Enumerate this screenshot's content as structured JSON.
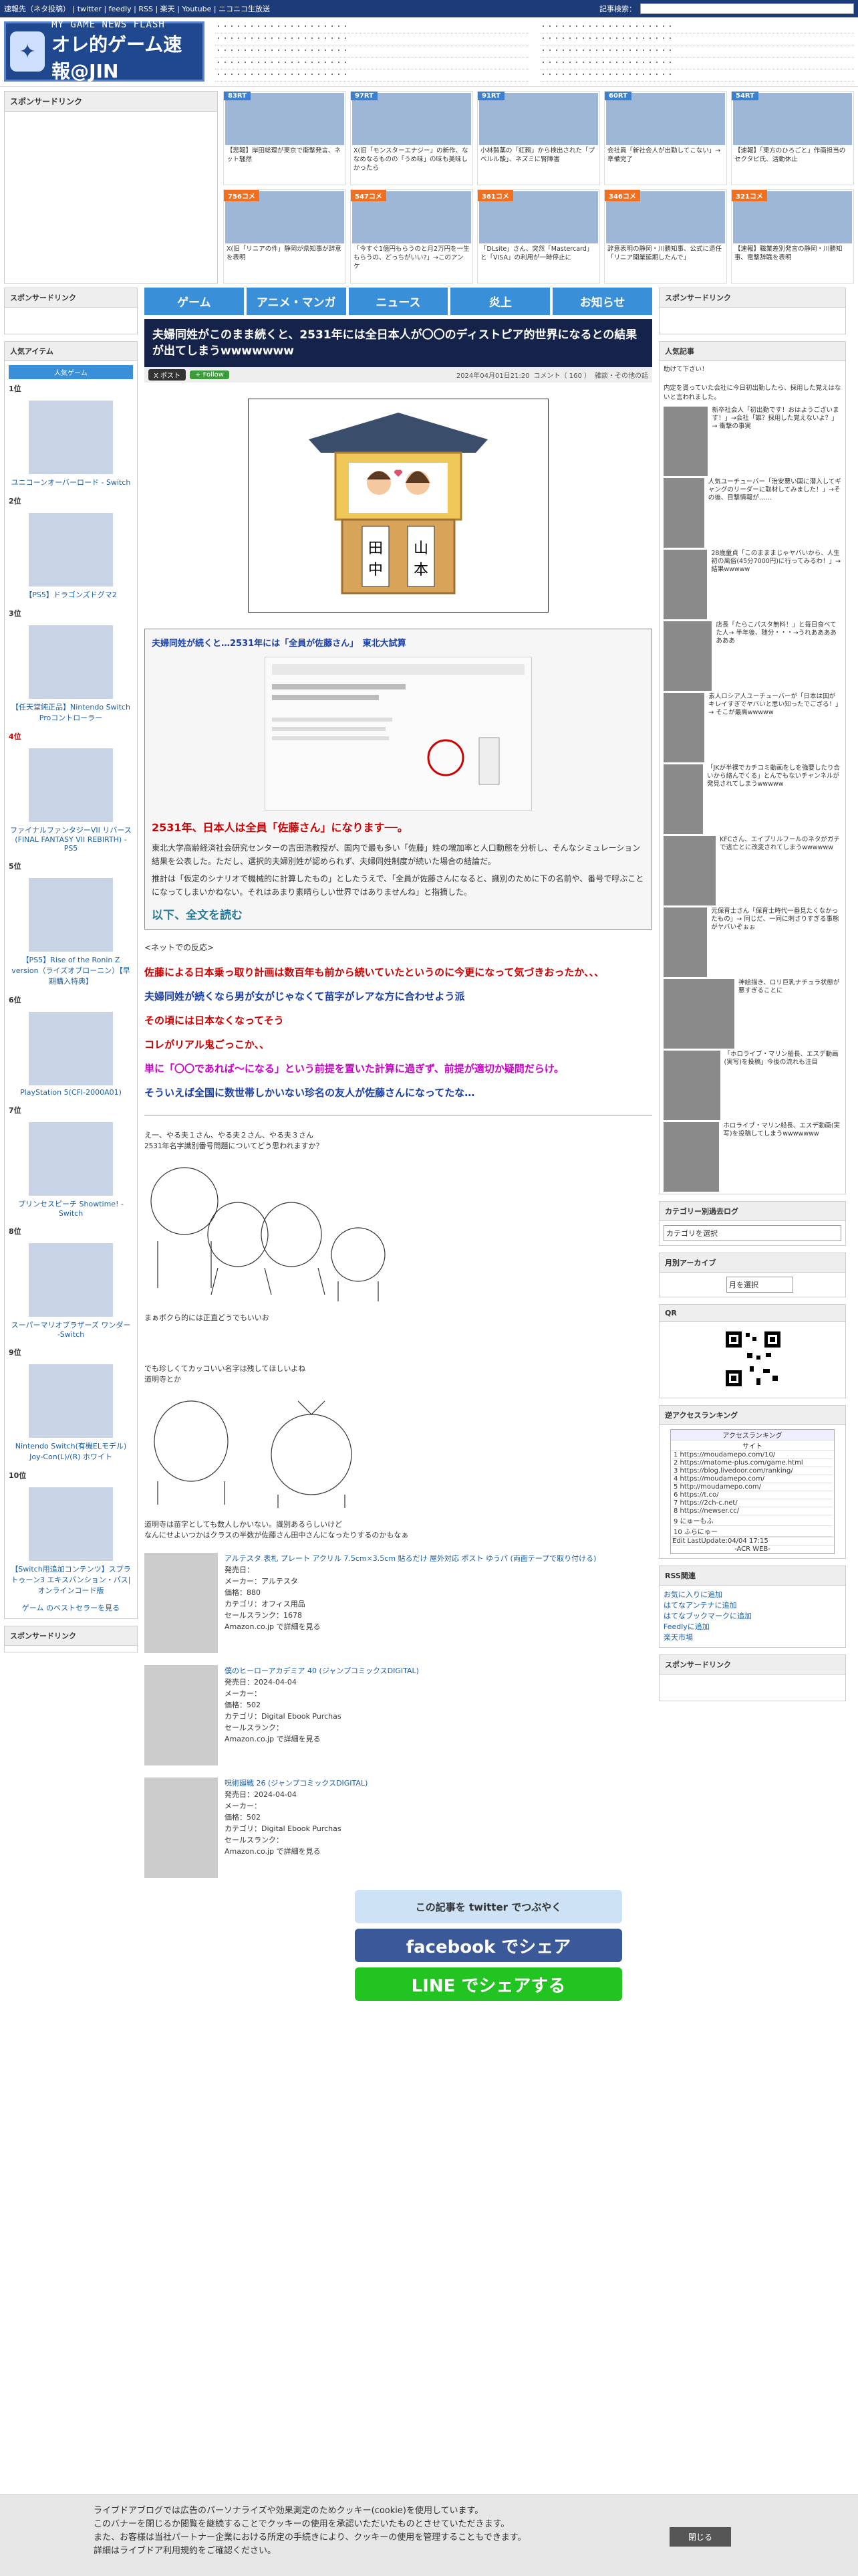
{
  "topbar": {
    "links": "速報先（ネタ投稿） | twitter | feedly | RSS | 楽天 | Youtube | ニコニコ生放送",
    "search_label": "記事検索："
  },
  "site": {
    "title_en": "MY GAME NEWS FLASH",
    "title_jp": "オレ的ゲーム速報@JIN"
  },
  "sponsored": "スポンサードリンク",
  "thumbs": [
    {
      "badge": "83RT",
      "caption": "【悲報】岸田総理が東京で衝撃発言、ネット騒然",
      "color": "#3a7fd0"
    },
    {
      "badge": "97RT",
      "caption": "X(旧「モンスターエナジー」の新作、ななめなるものの「うめ味」の味も美味しかったら",
      "color": "#3a7fd0"
    },
    {
      "badge": "91RT",
      "caption": "小林製薬の「紅麹」から検出された「プベルル酸」、ネズミに腎障害",
      "color": "#3a7fd0"
    },
    {
      "badge": "60RT",
      "caption": "会社員「新社会人が出勤してこない」→準備完了",
      "color": "#3a7fd0"
    },
    {
      "badge": "54RT",
      "caption": "【速報】「東方のひろごと」作画担当のセクタビ氏、活動休止",
      "color": "#3a7fd0"
    },
    {
      "badge": "756コメ",
      "caption": "X(旧「リニアの件」静岡が県知事が辞意を表明",
      "color": "#f07020"
    },
    {
      "badge": "547コメ",
      "caption": "「今すぐ1億円もらうのと月2万円を一生もらうの、どっちがいい?」→このアンケ",
      "color": "#f07020"
    },
    {
      "badge": "361コメ",
      "caption": "「DLsite」さん、突然「Mastercard」と「VISA」の利用が一時停止に",
      "color": "#f07020"
    },
    {
      "badge": "346コメ",
      "caption": "辞意表明の静岡・川勝知事、公式に退任「リニア開業延期したんで」",
      "color": "#f07020"
    },
    {
      "badge": "321コメ",
      "caption": "【速報】職業差別発言の静岡・川勝知事、電撃辞職を表明",
      "color": "#f07020"
    }
  ],
  "nav": [
    "ゲーム",
    "アニメ・マンガ",
    "ニュース",
    "炎上",
    "お知らせ"
  ],
  "article": {
    "title": "夫婦同姓がこのまま続くと、2531年には全日本人が〇〇のディストピア的世界になるとの結果が出てしまうwwwwwww",
    "date": "2024年04月01日21:20",
    "comments": "コメント（ 160 ）",
    "cat": "雑談・その他の話",
    "quote_title": "夫婦同姓が続くと…2531年には「全員が佐藤さん」　東北大試算",
    "big": "2531年、日本人は全員「佐藤さん」になります──。",
    "p1": "東北大学高齢経済社会研究センターの吉田浩教授が、国内で最も多い「佐藤」姓の増加率と人口動態を分析し、そんなシミュレーション結果を公表した。ただし、選択的夫婦別姓が認められず、夫婦同姓制度が続いた場合の結論だ。",
    "p2": "推計は「仮定のシナリオで機械的に計算したもの」としたうえで、「全員が佐藤さんになると、識別のために下の名前や、番号で呼ぶことになってしまいかねない。それはあまり素晴らしい世界ではありませんね」と指摘した。",
    "more": "以下、全文を読む",
    "net": "<ネットでの反応>",
    "reactions": [
      {
        "t": "佐藤による日本乗っ取り計画は数百年も前から続いていたというのに今更になって気づきおったか、、、",
        "c": "#c00"
      },
      {
        "t": "夫婦同姓が続くなら男が女がじゃなくて苗字がレアな方に合わせよう派",
        "c": "#1a3ea8"
      },
      {
        "t": "その頃には日本なくなってそう",
        "c": "#c00"
      },
      {
        "t": "コレがリアル鬼ごっこか、、",
        "c": "#c00"
      },
      {
        "t": "単に「〇〇であれば〜になる」という前提を置いた計算に過ぎず、前提が適切か疑問だらけ。",
        "c": "#c0c"
      },
      {
        "t": "そういえば全国に数世帯しかいない珍名の友人が佐藤さんになってたな…",
        "c": "#1a3ea8"
      }
    ],
    "aa1": "え一、やる夫１さん、やる夫２さん、やる夫３さん\n2531年名字識別番号問題についてどう思われますか？",
    "aa1b": "まぁボクら的には正直どうでもいいお",
    "aa2": "でも珍しくてカッコいい名字は残してほしいよね\n道明寺とか",
    "aa2b": "道明寺は苗字としても数人しかいない。識別あるらしいけど\nなんにせよいつかはクラスの半数が佐藤さん田中さんになったりするのかもなぁ",
    "products": [
      {
        "title": "アルテスタ 表札 プレート アクリル 7.5cm×3.5cm 貼るだけ 屋外対応 ポスト ゆうパ (両面テープで取り付ける)",
        "lines": [
          "発売日：",
          "メーカー：アルテスタ",
          "価格：880",
          "カテゴリ：オフィス用品",
          "セールスランク：1678",
          "Amazon.co.jp で詳細を見る"
        ]
      },
      {
        "title": "僕のヒーローアカデミア 40 (ジャンプコミックスDIGITAL)",
        "lines": [
          "発売日：2024-04-04",
          "メーカー：",
          "価格：502",
          "カテゴリ：Digital Ebook Purchas",
          "セールスランク：",
          "Amazon.co.jp で詳細を見る"
        ]
      },
      {
        "title": "呪術廻戦 26 (ジャンプコミックスDIGITAL)",
        "lines": [
          "発売日：2024-04-04",
          "メーカー：",
          "価格：502",
          "カテゴリ：Digital Ebook Purchas",
          "セールスランク：",
          "Amazon.co.jp で詳細を見る"
        ]
      }
    ],
    "share": [
      {
        "t": "この記事を twitter でつぶやく",
        "c": "#cde3f5"
      },
      {
        "t": "facebook でシェア",
        "c": "#3b5998"
      },
      {
        "t": "LINE でシェアする",
        "c": "#21c421"
      }
    ]
  },
  "left": {
    "popular": "人気アイテム",
    "tab": "人気ゲーム",
    "items": [
      {
        "rank": "1位",
        "name": "ユニコーンオーバーロード - Switch"
      },
      {
        "rank": "2位",
        "name": "【PS5】ドラゴンズドグマ2"
      },
      {
        "rank": "3位",
        "name": "【任天堂純正品】Nintendo Switch Proコントローラー"
      },
      {
        "rank": "4位",
        "name": "ファイナルファンタジーVII リバース(FINAL FANTASY VII REBIRTH) -PS5"
      },
      {
        "rank": "5位",
        "name": "【PS5】Rise of the Ronin Z version（ライズオブローニン）【早期購入特典】"
      },
      {
        "rank": "6位",
        "name": "PlayStation 5(CFI-2000A01)"
      },
      {
        "rank": "7位",
        "name": "プリンセスピーチ Showtime! -Switch"
      },
      {
        "rank": "8位",
        "name": "スーパーマリオブラザーズ ワンダー -Switch"
      },
      {
        "rank": "9位",
        "name": "Nintendo Switch(有機ELモデル) Joy-Con(L)/(R) ホワイト"
      },
      {
        "rank": "10位",
        "name": "【Switch用追加コンテンツ】スプラトゥーン3 エキスパンション・パス|オンラインコード版"
      }
    ],
    "bestseller": "ゲーム のベストセラーを見る",
    "sponsored2": "スポンサードリンク"
  },
  "right": {
    "sponsored": "スポンサードリンク",
    "popular": "人気記事",
    "intro": "助けて下さい！\n\n内定を貰っていた会社に今日初出勤したら、採用した覚えはないと言われました。",
    "articles": [
      "新卒社会人「初出勤です！おはようございます！」→会社「誰？採用した覚えないよ？」→ 衝撃の事実",
      "人気ユーチューバー「治安悪い国に潜入してギャングのリーダーに取材してみました！」→その後、目撃情報が……",
      "28歳童貞「このまままじゃヤバいから、人生初の風俗(45分7000円)に行ってみるわ！」→ 結果wwwww",
      "店長「たらこパスタ無料！」と毎日食べてた人→ 半年後、随分・・・→うれあああああああ",
      "素人ロシア人ユーチューバーが「日本は国がキレイすぎでヤバいと思い知ったでござる！」→ そこが最高wwwww",
      "「JKが半裸でカチコミ動画をしを強要したり合いから絡んでくる」とんでもないチャンネルが発見されてしまうwwwww",
      "KFCさん、エイプリルフールのネタがガチで逃亡とに改変されてしまうwwwwww",
      "元保育士さん「保育士時代一番見たくなかったもの」→ 同じだ、一同に刺さりすぎる事態がヤバいぞぉぉ",
      "神絵描き、ロリ巨乳ナチュラ状態が悪すぎることに",
      "「ホロライブ・マリン船長、エスデ動画(実写)を投稿」今後の流れも注目",
      "ホロライブ・マリン船長、エスデ動画(実写)を投稿してしまうwwwwwww"
    ],
    "cat_log": "カテゴリー別過去ログ",
    "cat_select": "カテゴリを選択",
    "monthly": "月別アーカイブ",
    "month_select": "月を選択",
    "qr": "QR",
    "acr": "逆アクセスランキング",
    "acr_title": "アクセスランキング",
    "acr_head": "サイト",
    "acr_rows": [
      "1 https://moudamepo.com/10/",
      "2 https://matome-plus.com/game.html",
      "3 https://blog.livedoor.com/ranking/",
      "4 https://moudamepo.com/",
      "5 http://moudamepo.com/",
      "6 https://t.co/",
      "7 https://2ch-c.net/",
      "8 https://newser.cc/",
      "9 にゅーもふ",
      "10 ふらにゅー"
    ],
    "acr_update": "Edit  LastUpdate:04/04 17:15",
    "acr_web": "-ACR WEB-",
    "rss": "RSS関連",
    "rss_links": [
      "お気に入りに追加",
      "はてなアンテナに追加",
      "はてなブックマークに追加",
      "Feedlyに追加",
      "楽天市場"
    ],
    "sponsored3": "スポンサードリンク"
  },
  "cookie": {
    "text": "ライブドアブログでは広告のパーソナライズや効果測定のためクッキー(cookie)を使用しています。\nこのバナーを閉じるか閲覧を継続することでクッキーの使用を承認いただいたものとさせていただきます。\nまた、お客様は当社パートナー企業における所定の手続きにより、クッキーの使用を管理することもできます。\n詳細はライブドア利用規約をご確認ください。",
    "close": "閉じる"
  }
}
